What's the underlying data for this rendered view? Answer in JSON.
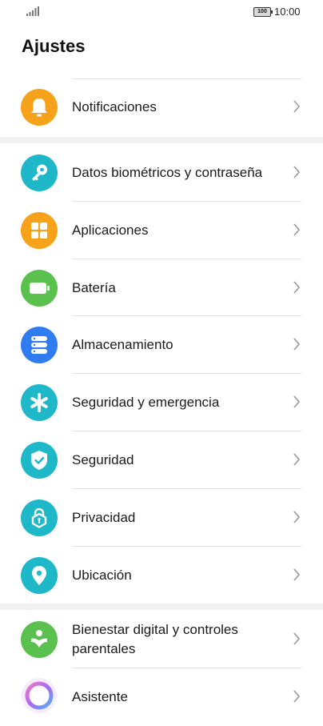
{
  "status_bar": {
    "battery": "100",
    "time": "10:00"
  },
  "title": "Ajustes",
  "items": [
    {
      "label": "Notificaciones",
      "icon": "bell-icon",
      "color": "#f7a21b"
    },
    {
      "label": "Datos biométricos y contraseña",
      "icon": "key-icon",
      "color": "#1fb8c9"
    },
    {
      "label": "Aplicaciones",
      "icon": "apps-grid-icon",
      "color": "#f7a21b"
    },
    {
      "label": "Batería",
      "icon": "battery-icon",
      "color": "#5ac04e"
    },
    {
      "label": "Almacenamiento",
      "icon": "storage-icon",
      "color": "#2f7bf0"
    },
    {
      "label": "Seguridad y emergencia",
      "icon": "asterisk-icon",
      "color": "#1fb8c9"
    },
    {
      "label": "Seguridad",
      "icon": "shield-icon",
      "color": "#1fb8c9"
    },
    {
      "label": "Privacidad",
      "icon": "privacy-lock-icon",
      "color": "#1fb8c9"
    },
    {
      "label": "Ubicación",
      "icon": "location-pin-icon",
      "color": "#1fb8c9"
    },
    {
      "label": "Bienestar digital y controles parentales",
      "icon": "wellbeing-icon",
      "color": "#5ac04e"
    },
    {
      "label": "Asistente",
      "icon": "assistant-orb-icon",
      "color": "#c86fe8"
    }
  ]
}
